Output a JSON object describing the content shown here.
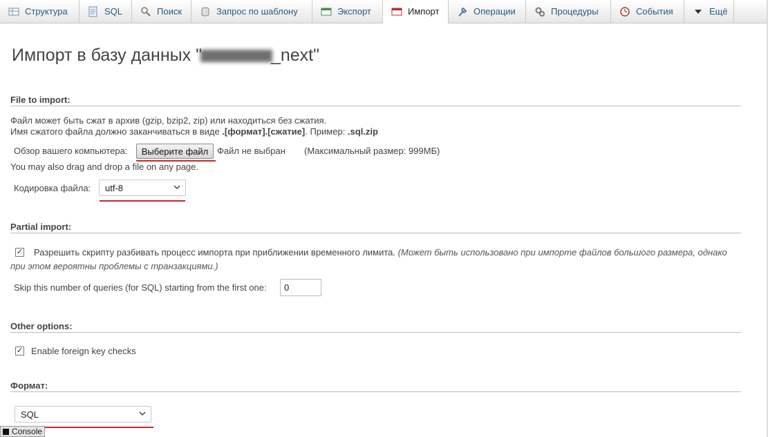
{
  "tabs": [
    {
      "label": "Структура",
      "icon": "structure-icon"
    },
    {
      "label": "SQL",
      "icon": "sql-icon"
    },
    {
      "label": "Поиск",
      "icon": "search-icon"
    },
    {
      "label": "Запрос по шаблону",
      "icon": "query-icon"
    },
    {
      "label": "Экспорт",
      "icon": "export-icon"
    },
    {
      "label": "Импорт",
      "icon": "import-icon",
      "active": true
    },
    {
      "label": "Операции",
      "icon": "wrench-icon"
    },
    {
      "label": "Процедуры",
      "icon": "routines-icon"
    },
    {
      "label": "События",
      "icon": "clock-icon"
    },
    {
      "label": "Ещё",
      "icon": "chevron-down-icon"
    }
  ],
  "page": {
    "title_prefix": "Импорт в базу данных \"",
    "title_suffix": "_next\""
  },
  "file_import": {
    "heading": "File to import:",
    "line1": "Файл может быть сжат в архив (gzip, bzip2, zip) или находиться без сжатия.",
    "line2_a": "Имя сжатого файла должно заканчиваться в виде ",
    "line2_b": ".[формат].[сжатие]",
    "line2_c": ". Пример: ",
    "line2_d": ".sql.zip",
    "browse_label": "Обзор вашего компьютера:",
    "choose_button": "Выберите файл",
    "no_file": "Файл не выбран",
    "max_size": "(Максимальный размер: 999МБ)",
    "drag_hint": "You may also drag and drop a file on any page.",
    "charset_label": "Кодировка файла:",
    "charset_value": "utf-8"
  },
  "partial_import": {
    "heading": "Partial import:",
    "allow_interrupt_label": "Разрешить скрипту разбивать процесс импорта при приближении временного лимита.",
    "allow_interrupt_note1": "(Может быть использовано при импорте файлов большого размера, однако",
    "allow_interrupt_note2": "при этом вероятны проблемы с транзакциями.)",
    "skip_label": "Skip this number of queries (for SQL) starting from the first one:",
    "skip_value": "0",
    "allow_interrupt_checked": true
  },
  "other_options": {
    "heading": "Other options:",
    "fk_label": "Enable foreign key checks",
    "fk_checked": true
  },
  "format": {
    "heading": "Формат:",
    "value": "SQL"
  },
  "console": {
    "label": "Console"
  },
  "colors": {
    "tab_text": "#235a81",
    "underline_red": "#c8262c"
  }
}
